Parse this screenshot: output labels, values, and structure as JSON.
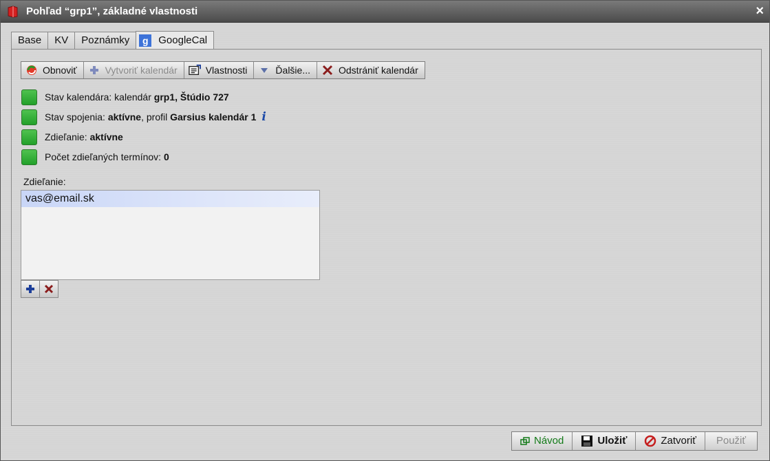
{
  "window": {
    "title": "Pohľad “grp1”, základné vlastnosti",
    "close_symbol": "×"
  },
  "tabs": [
    {
      "label": "Base",
      "active": false
    },
    {
      "label": "KV",
      "active": false
    },
    {
      "label": "Poznámky",
      "active": false
    },
    {
      "label": "GoogleCal",
      "active": true,
      "icon": "google-icon",
      "icon_text": "g"
    }
  ],
  "toolbar": {
    "refresh": {
      "label": "Obnoviť",
      "icon": "refresh-icon"
    },
    "create": {
      "label": "Vytvoriť kalendár",
      "icon": "plus-icon",
      "disabled": true
    },
    "properties": {
      "label": "Vlastnosti",
      "icon": "properties-icon"
    },
    "more": {
      "label": "Ďalšie...",
      "icon": "dropdown-arrow-icon"
    },
    "remove": {
      "label": "Odstrániť kalendár",
      "icon": "delete-icon"
    }
  },
  "status": {
    "calendar": {
      "label": "Stav kalendára: kalendár ",
      "value": "grp1, Štúdio 727"
    },
    "connection": {
      "label": "Stav spojenia: ",
      "value": "aktívne",
      "middle": ", profil ",
      "profile": "Garsius kalendár 1",
      "info_icon_text": "i"
    },
    "sharing": {
      "label": "Zdieľanie: ",
      "value": "aktívne"
    },
    "shared_count": {
      "label": "Počet zdieľaných termínov: ",
      "value": "0"
    }
  },
  "sharing_list": {
    "label": "Zdieľanie:",
    "items": [
      "vas@email.sk"
    ]
  },
  "bottom_buttons": {
    "help": "Návod",
    "save": "Uložiť",
    "close": "Zatvoriť",
    "apply": "Použiť"
  },
  "colors": {
    "status_ok": "#2fae33",
    "help_text": "#137a18"
  }
}
